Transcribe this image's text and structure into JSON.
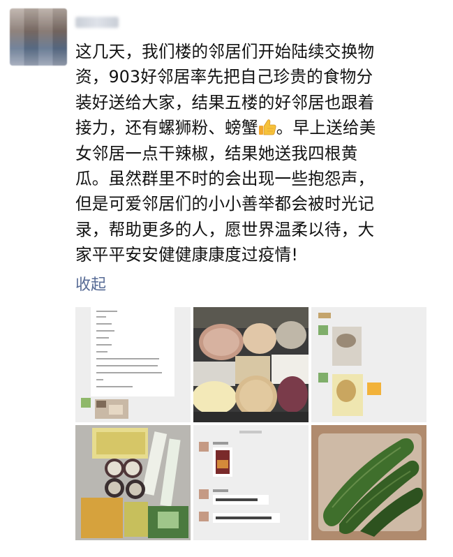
{
  "post": {
    "author_name": "邻居",
    "text_lines": [
      "这几天，我们楼的邻居们开始陆续交换物",
      "资，903好邻居率先把自己珍贵的食物分",
      "装好送给大家，结果五楼的好邻居也跟着",
      "接力，还有螺狮粉、螃蟹",
      "。早上送给美",
      "女邻居一点干辣椒，结果她送我四根黄",
      "瓜。虽然群里不时的会出现一些抱怨声，",
      "但是可爱邻居们的小小善举都会被时光记",
      "录，帮助更多的人，愿世界温柔以待，大",
      "家平平安安健健康康度过疫情!"
    ],
    "emoji": "thumbs-up-icon",
    "collapse_label": "收起"
  },
  "photos": [
    {
      "name": "chat-list-screenshot"
    },
    {
      "name": "food-bags-photo"
    },
    {
      "name": "chat-photos-screenshot"
    },
    {
      "name": "snacks-photo"
    },
    {
      "name": "chat-message-screenshot"
    },
    {
      "name": "cucumbers-photo"
    }
  ],
  "colors": {
    "text": "#111111",
    "link": "#576b95",
    "background": "#ffffff"
  }
}
